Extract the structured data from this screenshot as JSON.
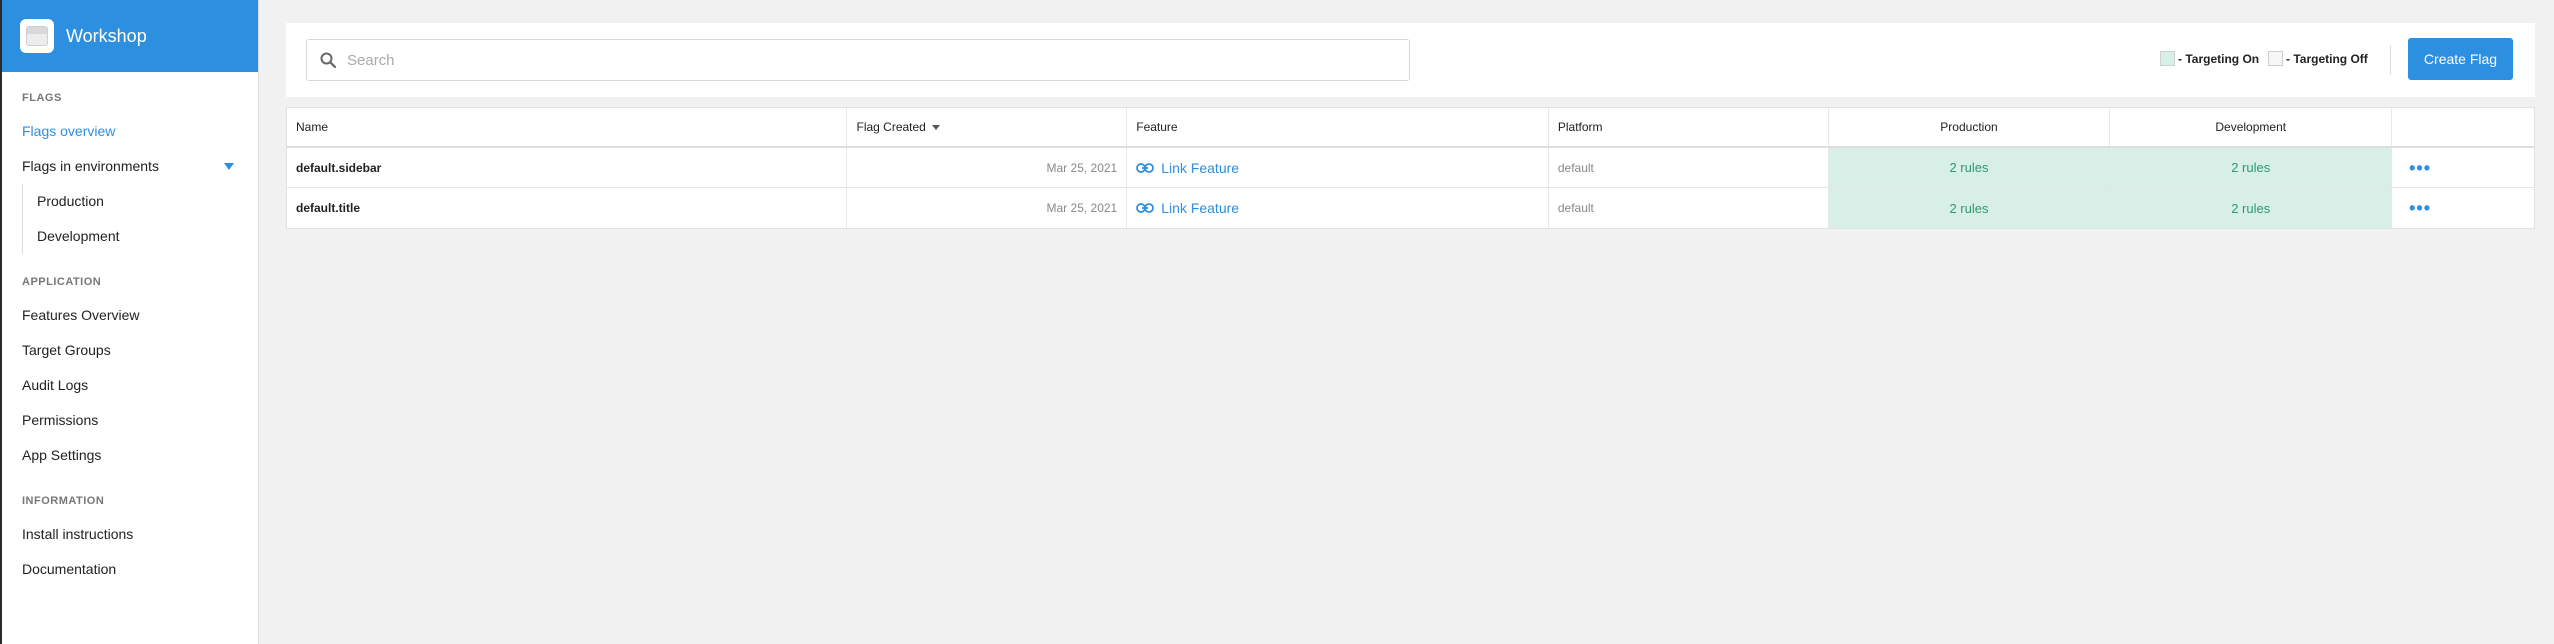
{
  "brand": {
    "name": "Workshop"
  },
  "sidebar": {
    "sections": [
      {
        "title": "FLAGS"
      },
      {
        "title": "APPLICATION"
      },
      {
        "title": "INFORMATION"
      }
    ],
    "flags": {
      "overview": "Flags overview",
      "environments": "Flags in environments",
      "env_items": [
        "Production",
        "Development"
      ]
    },
    "application": [
      "Features Overview",
      "Target Groups",
      "Audit Logs",
      "Permissions",
      "App Settings"
    ],
    "information": [
      "Install instructions",
      "Documentation"
    ]
  },
  "toolbar": {
    "search_placeholder": "Search",
    "legend_on": "- Targeting On",
    "legend_off": "- Targeting Off",
    "create_label": "Create Flag"
  },
  "table": {
    "headers": {
      "name": "Name",
      "created": "Flag Created",
      "feature": "Feature",
      "platform": "Platform",
      "production": "Production",
      "development": "Development"
    },
    "rows": [
      {
        "name": "default.sidebar",
        "created": "Mar 25, 2021",
        "feature": "Link Feature",
        "platform": "default",
        "production": "2 rules",
        "development": "2 rules"
      },
      {
        "name": "default.title",
        "created": "Mar 25, 2021",
        "feature": "Link Feature",
        "platform": "default",
        "production": "2 rules",
        "development": "2 rules"
      }
    ],
    "actions_glyph": "•••"
  },
  "colors": {
    "accent": "#2d8fe0",
    "targeting_on": "#d7efe7",
    "rules_text": "#2a9a6e"
  },
  "icons": [
    "search-icon",
    "link-icon",
    "chevron-down-icon",
    "more-icon"
  ]
}
